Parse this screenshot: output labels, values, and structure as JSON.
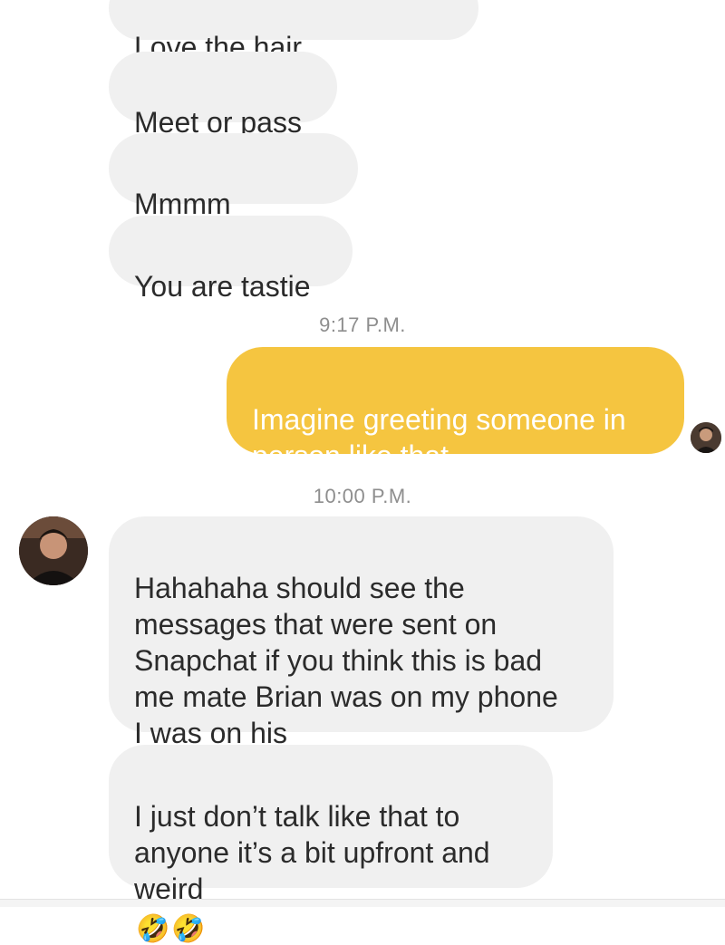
{
  "messages": [
    {
      "text": "Love the hair",
      "emojis": [
        "❤",
        "❤",
        "🍆"
      ]
    },
    {
      "text": "Meet or pass",
      "emojis": []
    },
    {
      "text": "Mmmm",
      "emojis": [
        "❤",
        "❤"
      ]
    },
    {
      "text": "You are tastie",
      "emojis": []
    },
    {
      "text": "Imagine greeting someone in\nperson like that",
      "emojis": []
    },
    {
      "text": "Hahahaha should see the\nmessages that were sent on\nSnapchat if you think this is bad\nme mate Brian was on my phone\nI was on his",
      "emojis": [
        "😂",
        "😂"
      ]
    },
    {
      "text": "I just don’t talk like that to\nanyone it’s a bit upfront and\nweird",
      "emojis": [
        "🤣",
        "🤣"
      ]
    }
  ],
  "timestamps": [
    "9:17 P.M.",
    "10:00 P.M."
  ],
  "icons": {
    "heart": "heart-emoji",
    "eggplant": "eggplant-emoji",
    "laugh": "tears-of-joy-emoji",
    "rofl": "rolling-laughing-emoji"
  },
  "colors": {
    "incoming_bubble": "#f0f0f0",
    "outgoing_bubble": "#f5c540",
    "timestamp": "#8e8e8e"
  }
}
